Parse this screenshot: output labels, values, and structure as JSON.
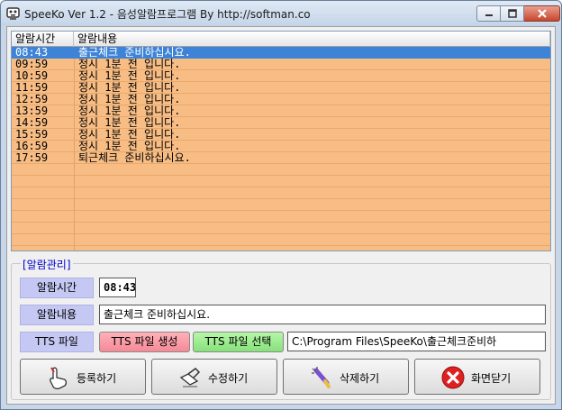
{
  "window": {
    "title": "SpeeKo Ver 1.2 - 음성알람프로그램 By http://softman.co"
  },
  "list": {
    "columns": [
      "알람시간",
      "알람내용"
    ],
    "rows": [
      {
        "time": "08:43",
        "msg": "출근체크 준비하십시요.",
        "selected": true
      },
      {
        "time": "09:59",
        "msg": "정시 1분 전 입니다."
      },
      {
        "time": "10:59",
        "msg": "정시 1분 전 입니다."
      },
      {
        "time": "11:59",
        "msg": "정시 1분 전 입니다."
      },
      {
        "time": "12:59",
        "msg": "정시 1분 전 입니다."
      },
      {
        "time": "13:59",
        "msg": "정시 1분 전 입니다."
      },
      {
        "time": "14:59",
        "msg": "정시 1분 전 입니다."
      },
      {
        "time": "15:59",
        "msg": "정시 1분 전 입니다."
      },
      {
        "time": "16:59",
        "msg": "정시 1분 전 입니다."
      },
      {
        "time": "17:59",
        "msg": "퇴근체크 준비하십시요."
      }
    ]
  },
  "manage": {
    "title": "[알람관리]",
    "time_label": "알람시간",
    "time_value": "08:43",
    "content_label": "알람내용",
    "content_value": "출근체크 준비하십시요.",
    "tts_label": "TTS 파일",
    "tts_generate": "TTS 파일 생성",
    "tts_select": "TTS 파일 선택",
    "tts_path": "C:\\Program Files\\SpeeKo\\출근체크준비하"
  },
  "buttons": {
    "register": "등록하기",
    "edit": "수정하기",
    "delete": "삭제하기",
    "close": "화면닫기"
  },
  "colors": {
    "list_bg": "#f7bd84",
    "selected": "#3d84d8",
    "label_bg": "#c6c8f4",
    "group_title": "#0000cc"
  }
}
